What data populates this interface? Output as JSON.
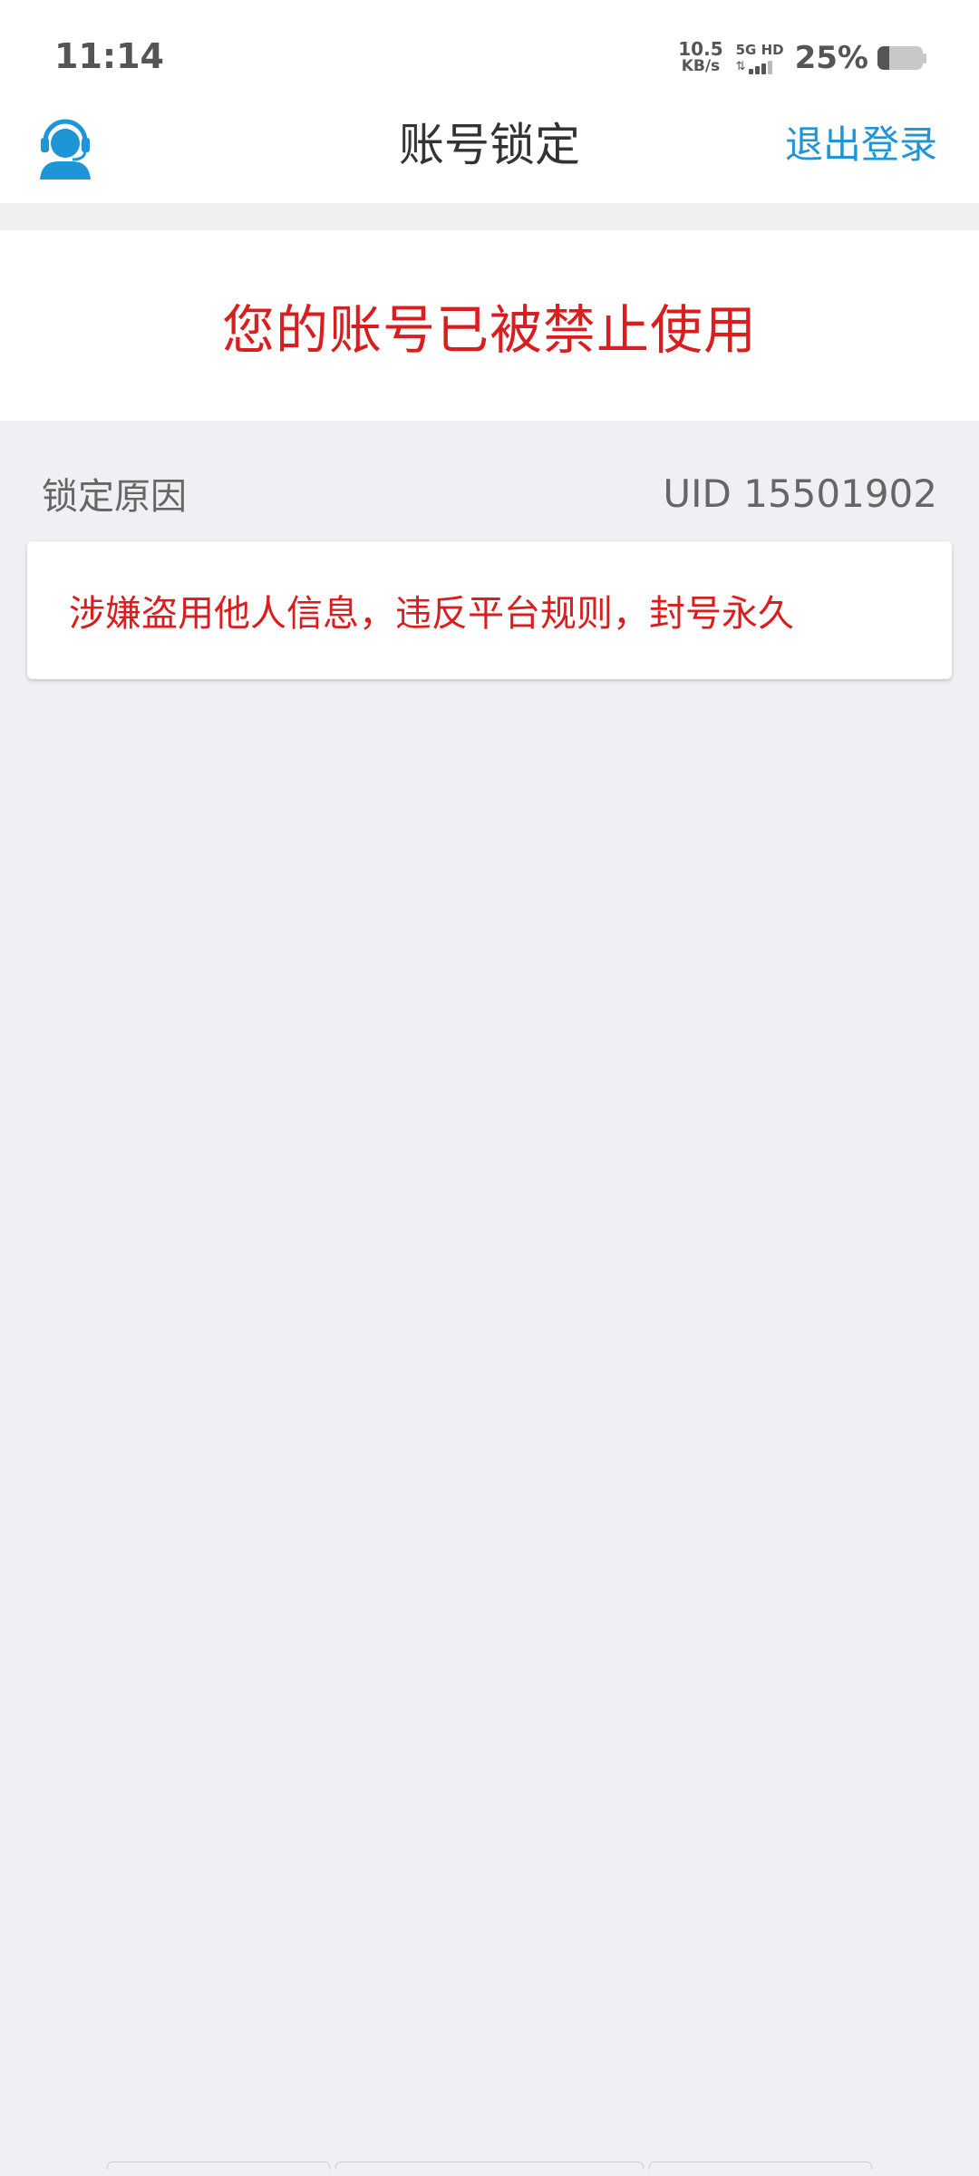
{
  "status_bar": {
    "time": "11:14",
    "net_speed_value": "10.5",
    "net_speed_unit": "KB/s",
    "network_label": "5G HD",
    "battery_percent": "25%",
    "battery_level": 0.25
  },
  "header": {
    "title": "账号锁定",
    "logout_label": "退出登录",
    "support_icon": "customer-service-icon",
    "accent_color": "#1e95d6"
  },
  "notice": {
    "message": "您的账号已被禁止使用",
    "color": "#d81e1e"
  },
  "lock_reason": {
    "label": "锁定原因",
    "uid": "UID 15501902",
    "reason_text": "涉嫌盗用他人信息，违反平台规则，封号永久"
  }
}
